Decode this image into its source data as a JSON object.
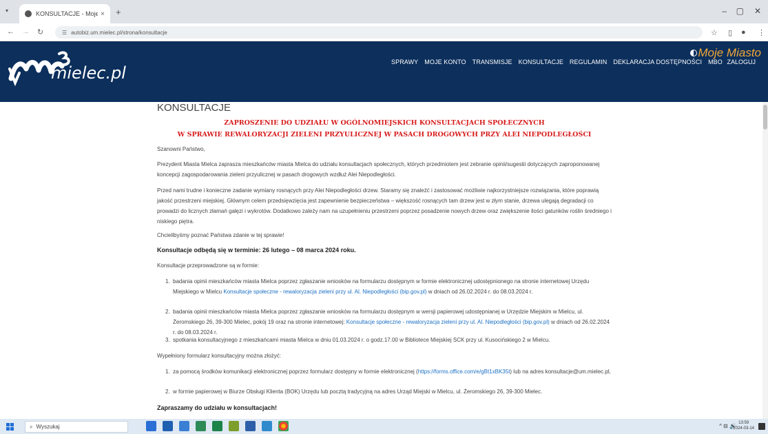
{
  "browser": {
    "tab_title": "KONSULTACJE - Moje Miasto",
    "tab_close": "×",
    "new_tab": "+",
    "url": "autobiz.um.mielec.pl/strona/konsultacje",
    "min": "–",
    "max": "▢",
    "close": "✕"
  },
  "header": {
    "logo_text": "mielec.pl",
    "moje_miasto": "Moje Miasto",
    "nav": [
      "SPRAWY",
      "MOJE KONTO",
      "TRANSMISJE",
      "KONSULTACJE",
      "REGULAMIN",
      "DEKLARACJA DOSTĘPNOŚCI",
      "MBO"
    ],
    "login": "ZALOGUJ"
  },
  "content": {
    "page_title": "KONSULTACJE",
    "heading_line1": "ZAPROSZENIE DO UDZIAŁU W OGÓLNOMIEJSKICH KONSULTACJACH SPOŁECZNYCH",
    "heading_line2": "W SPRAWIE REWALORYZACJI ZIELENI PRZYULICZNEJ W PASACH DROGOWYCH PRZY ALEI NIEPODLEGŁOŚCI",
    "greeting": "Szanowni Państwo,",
    "para1": "Prezydent Miasta Mielca zaprasza mieszkańców miasta Mielca do udziału konsultacjach społecznych, których przedmiotem jest zebranie opinii/sugestii dotyczących zaproponowanej koncepcji zagospodarowania zieleni przyulicznej w pasach drogowych wzdłuż Alei Niepodległości.",
    "para2": "Przed nami trudne i konieczne zadanie wymiany rosnących przy Alei Niepodległości drzew. Staramy się znaleźć i zastosować możliwie najkorzystniejsze rozwiązania, które poprawią jakość przestrzeni miejskiej. Głównym celem przedsięwzięcia jest zapewnienie bezpieczeństwa – większość rosnących tam drzew jest w złym stanie, drzewa ulegają degradacji co prowadzi do licznych złamań gałęzi i wykrotów. Dodatkowo zależy nam na uzupełnieniu przestrzeni poprzez posadzenie nowych drzew oraz zwiększenie ilości gatunków roślin średniego i niskiego piętra.",
    "para3": "Chcielibyśmy poznać Państwa zdanie w tej sprawie!",
    "term": "Konsultacje odbędą się w terminie: 26 lutego – 08 marca 2024 roku.",
    "forms_intro": "Konsultacje przeprowadzone są w formie:",
    "forms": [
      {
        "num": "1.",
        "pre": "badania opinii mieszkańców miasta Mielca poprzez zgłaszanie wniosków na formularzu dostępnym w formie elektronicznej udostępnionego na stronie internetowej Urzędu Miejskiego w Mielcu ",
        "link": "Konsultacje społeczne - rewaloryzacja zieleni przy ul. Al. Niepodległości (bip.gov.pl)",
        "post": " w dniach od 26.02.2024 r. do 08.03.2024 r."
      },
      {
        "num": "2.",
        "pre": "badania opinii mieszkańców miasta Mielca poprzez zgłaszanie wniosków na formularzu dostępnym w wersji papierowej udostępnianej w Urzędzie Miejskim w Mielcu, ul. Żeromskiego 26, 39-300 Mielec, pokój 19 oraz na stronie internetowej: ",
        "link": "Konsultacje społeczne - rewaloryzacja zieleni przy ul. Al. Niepodległości (bip.gov.pl)",
        "post": " w dniach od 26.02.2024 r. do 08.03.2024 r."
      },
      {
        "num": "3.",
        "pre": "spotkania konsultacyjnego z mieszkańcami miasta Mielca w dniu 01.03.2024 r. o godz.17.00 w Bibliotece Miejskiej SCK przy ul. Kusocińskiego 2 w Mielcu.",
        "link": "",
        "post": ""
      }
    ],
    "submit_intro": "Wypełniony formularz konsultacyjny można złożyć:",
    "submit": [
      {
        "num": "1.",
        "pre": "za pomocą środków komunikacji elektronicznej poprzez formularz dostępny w formie elektronicznej (",
        "link": "https://forms.office.com/e/gBt1xBK35t",
        "post": ") lub na adres konsultacje@um.mielec.pl,"
      },
      {
        "num": "2.",
        "pre": "w formie papierowej w Biurze Obsługi Klienta (BOK) Urzędu lub pocztą tradycyjną na adres Urząd Miejski w Mielcu, ul. Żeromskiego 26, 39-300 Mielec.",
        "link": "",
        "post": ""
      }
    ],
    "closing": "Zapraszamy do udziału w konsultacjach!"
  },
  "taskbar": {
    "search_placeholder": "Wyszukaj",
    "time": "13:59",
    "date": "2024-03-14",
    "tray": "^ ⊟ 🔊"
  },
  "colors": {
    "header_bg": "#0c2f5c",
    "accent": "#f0a637",
    "heading_red": "#d71d1d",
    "link": "#1a6fc4"
  }
}
